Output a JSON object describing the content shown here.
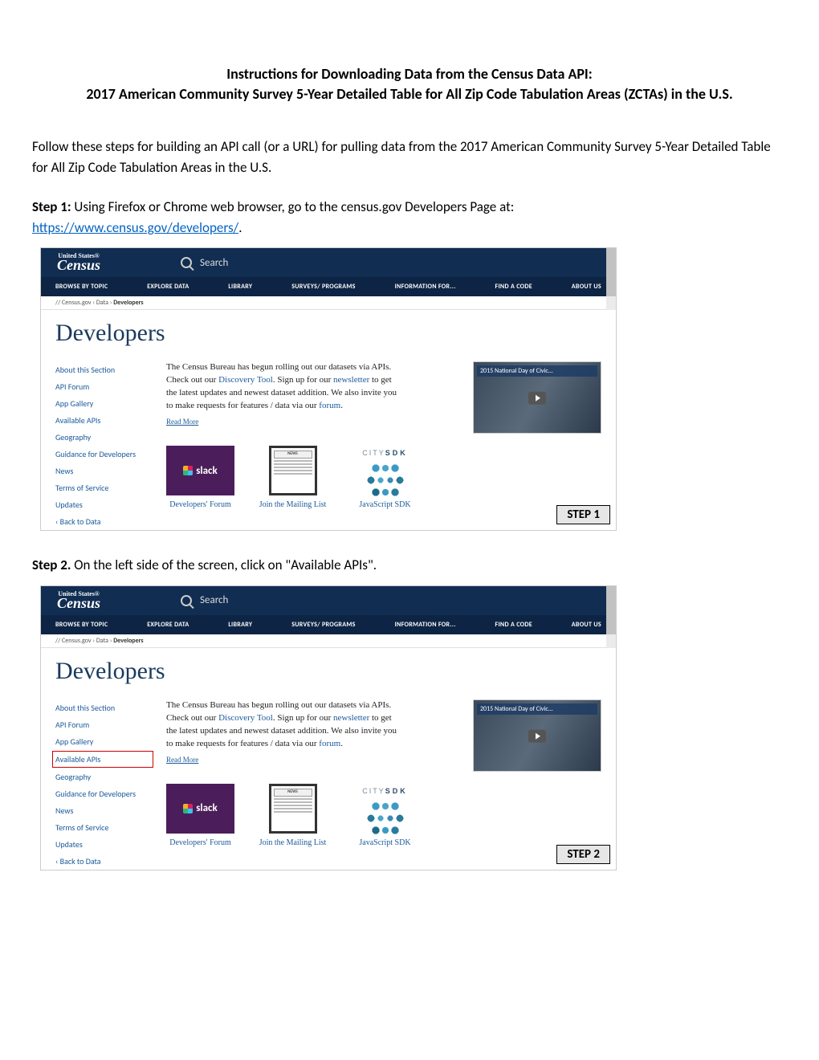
{
  "title_line1": "Instructions for Downloading Data from the Census Data API:",
  "title_line2": "2017 American Community Survey 5-Year Detailed Table for All Zip Code Tabulation Areas (ZCTAs) in the U.S.",
  "intro": "Follow these steps for building an API call (or a URL) for pulling data from the 2017 American Community Survey 5-Year Detailed Table for All Zip Code Tabulation Areas in the U.S.",
  "step1_label": "Step 1:",
  "step1_text": " Using Firefox or Chrome web browser, go to the census.gov Developers Page at: ",
  "step1_link": "https://www.census.gov/developers/",
  "step1_badge": "STEP 1",
  "step2_label": "Step 2.",
  "step2_text": " On the left side of the screen, click on \"Available APIs\".",
  "step2_badge": "STEP 2",
  "ss": {
    "logo_small": "United States®",
    "logo_main": "Census",
    "search_placeholder": "Search",
    "nav": [
      "BROWSE BY TOPIC",
      "EXPLORE DATA",
      "LIBRARY",
      "SURVEYS/ PROGRAMS",
      "INFORMATION FOR...",
      "FIND A CODE",
      "ABOUT US"
    ],
    "crumbs_prefix": "// Census.gov › Data › ",
    "crumbs_current": "Developers",
    "h1": "Developers",
    "side": [
      "About this Section",
      "API Forum",
      "App Gallery",
      "Available APIs",
      "Geography",
      "Guidance for Developers",
      "News",
      "Terms of Service",
      "Updates"
    ],
    "side_back": "‹ Back to Data",
    "desc_a": "The Census Bureau has begun rolling out our datasets via APIs.  Check out our ",
    "desc_link1": "Discovery Tool",
    "desc_b": ". Sign up for our ",
    "desc_link2": "newsletter",
    "desc_c": " to get the latest updates and newest dataset addition. We also invite you to make requests for features / data via our ",
    "desc_link3": "forum",
    "desc_d": ".",
    "readmore": "Read More",
    "video_caption": "2015 National Day of Civic...",
    "tile1": "slack",
    "tile1_cap": "Developers' Forum",
    "tile2_hdr": "NEWS",
    "tile2_cap": "Join the Mailing List",
    "tile3_hdr_a": "CITY",
    "tile3_hdr_b": "SDK",
    "tile3_cap": "JavaScript SDK"
  }
}
